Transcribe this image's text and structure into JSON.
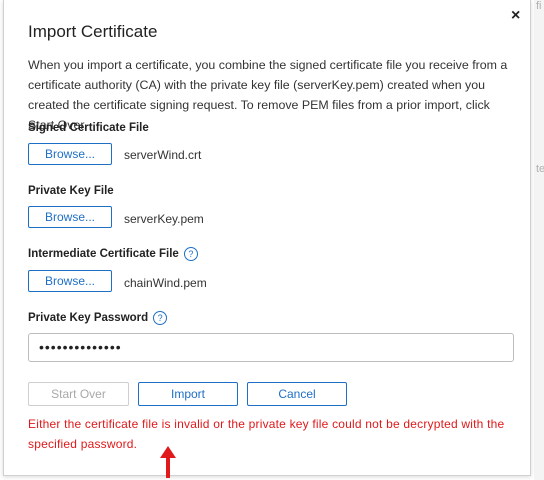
{
  "background": {
    "edge_fragments": [
      "fi",
      "te"
    ]
  },
  "dialog": {
    "title": "Import Certificate",
    "close_glyph": "×",
    "description": "When you import a certificate, you combine the signed certificate file you receive from a certificate authority (CA) with the private key file (serverKey.pem) created when you created the certificate signing request. To remove PEM files from a prior import, click Start Over.",
    "signed_cert": {
      "label": "Signed Certificate File",
      "browse_label": "Browse...",
      "file_name": "serverWind.crt"
    },
    "private_key": {
      "label": "Private Key File",
      "browse_label": "Browse...",
      "file_name": "serverKey.pem"
    },
    "intermediate_cert": {
      "label": "Intermediate Certificate File",
      "help_glyph": "?",
      "browse_label": "Browse...",
      "file_name": "chainWind.pem"
    },
    "password": {
      "label": "Private Key Password",
      "help_glyph": "?",
      "value_masked": "••••••••••••••"
    },
    "buttons": {
      "start_over": "Start Over",
      "import": "Import",
      "cancel": "Cancel"
    },
    "error_message": "Either the certificate file is invalid or the private key file could not be decrypted with the specified password."
  },
  "colors": {
    "accent": "#1e6fc6",
    "error": "#e0191b",
    "annotation_arrow": "#e0191b",
    "disabled": "#a8a8a8"
  },
  "icons": {
    "close": "close-icon",
    "help": "help-icon",
    "annotation": "up-arrow-icon"
  }
}
